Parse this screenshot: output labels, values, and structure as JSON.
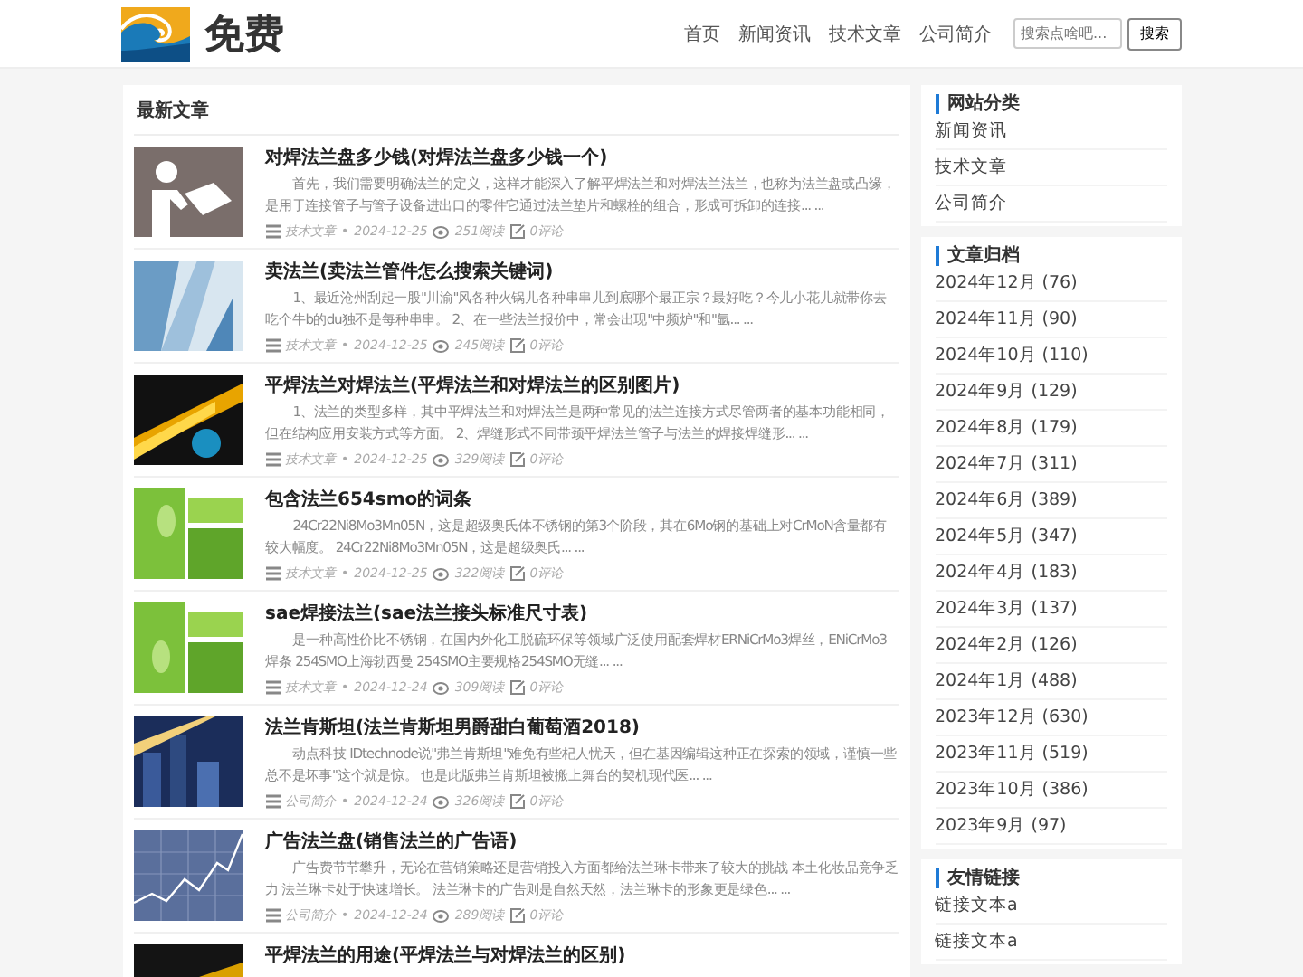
{
  "header": {
    "logo_text": "免费",
    "nav": [
      {
        "label": "首页"
      },
      {
        "label": "新闻资讯"
      },
      {
        "label": "技术文章"
      },
      {
        "label": "公司简介"
      }
    ],
    "search": {
      "placeholder": "搜索点啥吧...",
      "button": "搜索"
    }
  },
  "articles_section": {
    "title": "最新文章",
    "articles": [
      {
        "title": "对焊法兰盘多少钱(对焊法兰盘多少钱一个)",
        "excerpt": "首先，我们需要明确法兰的定义，这样才能深入了解平焊法兰和对焊法兰法兰，也称为法兰盘或凸缘，是用于连接管子与管子设备进出口的零件它通过法兰垫片和螺栓的组合，形成可拆卸的连接... ...",
        "category": "技术文章",
        "dot": "•",
        "date": "2024-12-25",
        "views": "251阅读",
        "comments": "0评论"
      },
      {
        "title": "卖法兰(卖法兰管件怎么搜索关键词)",
        "excerpt": "1、最近沧州刮起一股\"川渝\"风各种火锅儿各种串串儿到底哪个最正宗？最好吃？今儿小花儿就带你去吃个牛b的du独不是每种串串。 2、在一些法兰报价中，常会出现\"中频炉\"和\"氩... ...",
        "category": "技术文章",
        "dot": "•",
        "date": "2024-12-25",
        "views": "245阅读",
        "comments": "0评论"
      },
      {
        "title": "平焊法兰对焊法兰(平焊法兰和对焊法兰的区别图片)",
        "excerpt": "1、法兰的类型多样，其中平焊法兰和对焊法兰是两种常见的法兰连接方式尽管两者的基本功能相同，但在结构应用安装方式等方面。 2、焊缝形式不同带颈平焊法兰管子与法兰的焊接焊缝形... ...",
        "category": "技术文章",
        "dot": "•",
        "date": "2024-12-25",
        "views": "329阅读",
        "comments": "0评论"
      },
      {
        "title": "包含法兰654smo的词条",
        "excerpt": "24Cr22Ni8Mo3Mn05N，这是超级奥氏体不锈钢的第3个阶段，其在6Mo钢的基础上对CrMoN含量都有较大幅度。 24Cr22Ni8Mo3Mn05N，这是超级奥氏... ...",
        "category": "技术文章",
        "dot": "•",
        "date": "2024-12-25",
        "views": "322阅读",
        "comments": "0评论"
      },
      {
        "title": "sae焊接法兰(sae法兰接头标准尺寸表)",
        "excerpt": "是一种高性价比不锈钢，在国内外化工脱硫环保等领域广泛使用配套焊材ERNiCrMo3焊丝，ENiCrMo3焊条 254SMO上海勃西曼 254SMO主要规格254SMO无缝... ...",
        "category": "技术文章",
        "dot": "•",
        "date": "2024-12-24",
        "views": "309阅读",
        "comments": "0评论"
      },
      {
        "title": "法兰肯斯坦(法兰肯斯坦男爵甜白葡萄酒2018)",
        "excerpt": "动点科技 IDtechnode说\"弗兰肯斯坦\"难免有些杞人忧天，但在基因编辑这种正在探索的领域，谨慎一些总不是坏事\"这个就是惊。 也是此版弗兰肯斯坦被搬上舞台的契机现代医... ...",
        "category": "公司简介",
        "dot": "•",
        "date": "2024-12-24",
        "views": "326阅读",
        "comments": "0评论"
      },
      {
        "title": "广告法兰盘(销售法兰的广告语)",
        "excerpt": "广告费节节攀升，无论在营销策略还是营销投入方面都给法兰琳卡带来了较大的挑战 本土化妆品竞争乏力 法兰琳卡处于快速增长。 法兰琳卡的广告则是自然天然，法兰琳卡的形象更是绿色... ...",
        "category": "公司简介",
        "dot": "•",
        "date": "2024-12-24",
        "views": "289阅读",
        "comments": "0评论"
      },
      {
        "title": "平焊法兰的用途(平焊法兰与对焊法兰的区别)"
      }
    ]
  },
  "sidebar": [
    {
      "title": "网站分类",
      "items": [
        {
          "label": "新闻资讯"
        },
        {
          "label": "技术文章"
        },
        {
          "label": "公司简介"
        }
      ]
    },
    {
      "title": "文章归档",
      "items": [
        {
          "label": "2024年12月 (76)"
        },
        {
          "label": "2024年11月 (90)"
        },
        {
          "label": "2024年10月 (110)"
        },
        {
          "label": "2024年9月 (129)"
        },
        {
          "label": "2024年8月 (179)"
        },
        {
          "label": "2024年7月 (311)"
        },
        {
          "label": "2024年6月 (389)"
        },
        {
          "label": "2024年5月 (347)"
        },
        {
          "label": "2024年4月 (183)"
        },
        {
          "label": "2024年3月 (137)"
        },
        {
          "label": "2024年2月 (126)"
        },
        {
          "label": "2024年1月 (488)"
        },
        {
          "label": "2023年12月 (630)"
        },
        {
          "label": "2023年11月 (519)"
        },
        {
          "label": "2023年10月 (386)"
        },
        {
          "label": "2023年9月 (97)"
        }
      ]
    },
    {
      "title": "友情链接",
      "items": [
        {
          "label": "链接文本a"
        },
        {
          "label": "链接文本a"
        }
      ]
    }
  ]
}
